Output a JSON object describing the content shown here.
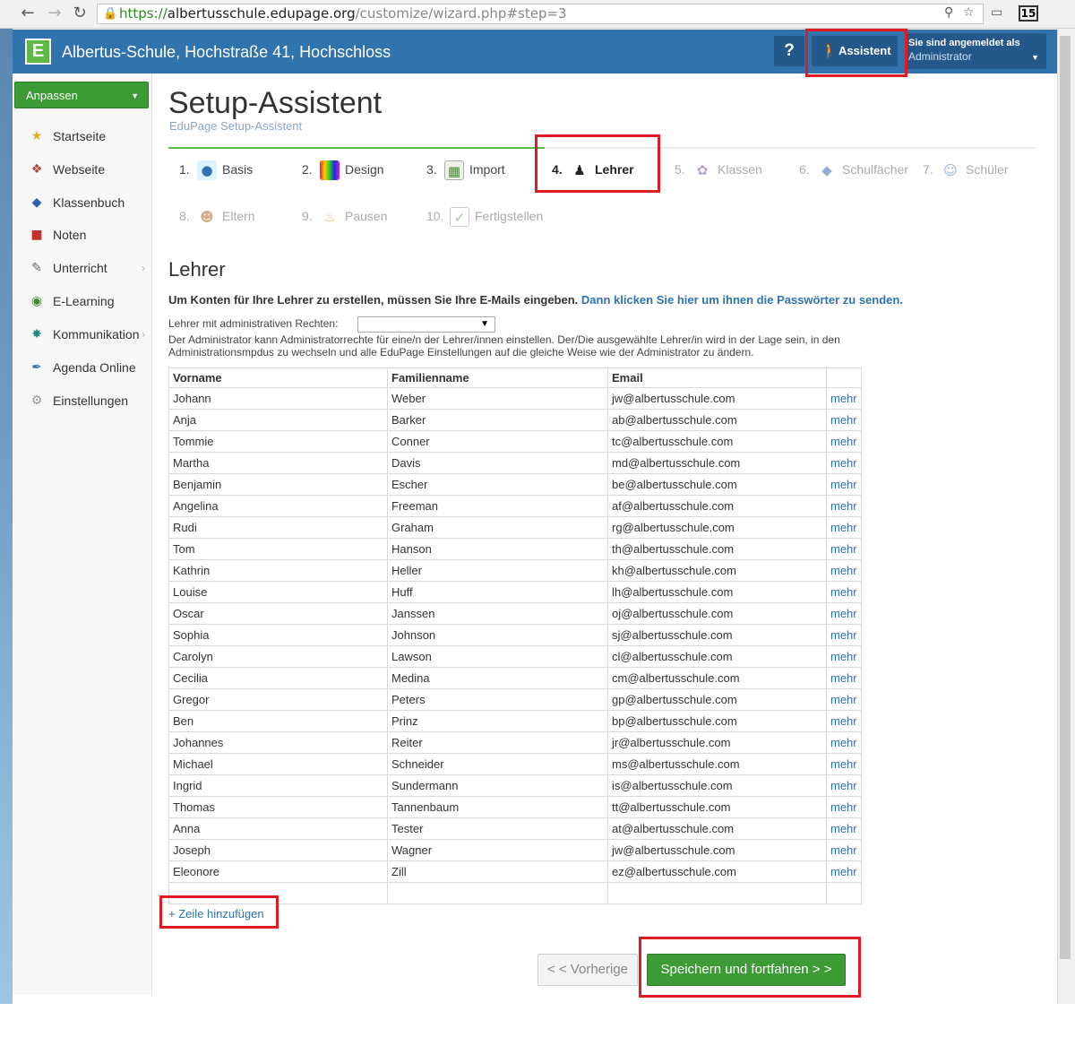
{
  "browser": {
    "url_protocol": "https://",
    "url_host": "albertusschule.edupage.org",
    "url_path": "/customize/wizard.php#step=3",
    "badge": "15"
  },
  "header": {
    "logo_letter": "E",
    "school_name": "Albertus-Schule, Hochstraße 41, Hochschloss",
    "help_label": "?",
    "assistant_label": "Assistent",
    "login_line1": "Sie sind angemeldet als",
    "login_line2": "Administrator"
  },
  "sidebar": {
    "customize_label": "Anpassen",
    "items": [
      {
        "label": "Startseite"
      },
      {
        "label": "Webseite"
      },
      {
        "label": "Klassenbuch"
      },
      {
        "label": "Noten"
      },
      {
        "label": "Unterricht"
      },
      {
        "label": "E-Learning"
      },
      {
        "label": "Kommunikation"
      },
      {
        "label": "Agenda Online"
      },
      {
        "label": "Einstellungen"
      }
    ]
  },
  "main": {
    "title": "Setup-Assistent",
    "subtitle": "EduPage Setup-Assistent",
    "steps": [
      {
        "num": "1.",
        "label": "Basis"
      },
      {
        "num": "2.",
        "label": "Design"
      },
      {
        "num": "3.",
        "label": "Import"
      },
      {
        "num": "4.",
        "label": "Lehrer"
      },
      {
        "num": "5.",
        "label": "Klassen"
      },
      {
        "num": "6.",
        "label": "Schulfächer"
      },
      {
        "num": "7.",
        "label": "Schüler"
      },
      {
        "num": "8.",
        "label": "Eltern"
      },
      {
        "num": "9.",
        "label": "Pausen"
      },
      {
        "num": "10.",
        "label": "Fertigstellen"
      }
    ],
    "section_title": "Lehrer",
    "intro_text": "Um Konten für Ihre Lehrer zu erstellen, müssen Sie Ihre E-Mails eingeben.",
    "intro_link": "Dann klicken Sie hier um ihnen die Passwörter zu senden.",
    "admin_label": "Lehrer mit administrativen Rechten:",
    "admin_select_value": "",
    "admin_desc": "Der Administrator kann Administratorrechte für eine/n der Lehrer/innen einstellen. Der/Die ausgewählte Lehrer/in wird in der Lage sein, in den Administrationsmpdus zu wechseln und alle EduPage Einstellungen auf die gleiche Weise wie der Administrator zu ändern.",
    "table": {
      "headers": [
        "Vorname",
        "Familienname",
        "Email",
        ""
      ],
      "more_label": "mehr",
      "rows": [
        [
          "Johann",
          " Weber",
          "jw@albertusschule.com"
        ],
        [
          "Anja",
          "Barker",
          "ab@albertusschule.com"
        ],
        [
          "Tommie",
          "Conner",
          "tc@albertusschule.com"
        ],
        [
          "Martha",
          "Davis",
          "md@albertusschule.com"
        ],
        [
          "Benjamin",
          "Escher",
          "be@albertusschule.com"
        ],
        [
          "Angelina",
          "Freeman",
          "af@albertusschule.com"
        ],
        [
          "Rudi",
          "Graham",
          "rg@albertusschule.com"
        ],
        [
          "Tom",
          "Hanson",
          "th@albertusschule.com"
        ],
        [
          "Kathrin",
          "Heller",
          "kh@albertusschule.com"
        ],
        [
          "Louise",
          "Huff",
          "lh@albertusschule.com"
        ],
        [
          "Oscar",
          "Janssen",
          "oj@albertusschule.com"
        ],
        [
          "Sophia",
          "Johnson",
          "sj@albertusschule.com"
        ],
        [
          "Carolyn",
          "Lawson",
          "cl@albertusschule.com"
        ],
        [
          "Cecilia",
          "Medina",
          "cm@albertusschule.com"
        ],
        [
          "Gregor",
          "Peters",
          "gp@albertusschule.com"
        ],
        [
          "Ben",
          "Prinz",
          "bp@albertusschule.com"
        ],
        [
          "Johannes",
          "Reiter",
          "jr@albertusschule.com"
        ],
        [
          "Michael",
          "Schneider",
          "ms@albertusschule.com"
        ],
        [
          "Ingrid",
          "Sundermann",
          "is@albertusschule.com"
        ],
        [
          "Thomas",
          "Tannenbaum",
          "tt@albertusschule.com"
        ],
        [
          "Anna",
          "Tester",
          "at@albertusschule.com"
        ],
        [
          "Joseph",
          "Wagner",
          "jw@albertusschule.com"
        ],
        [
          "Eleonore",
          "Zill",
          "ez@albertusschule.com"
        ]
      ]
    },
    "add_row_label": "+ Zeile hinzufügen",
    "prev_label": "< < Vorherige",
    "next_label": "Speichern und fortfahren > >"
  },
  "colors": {
    "header_blue": "#3173ad",
    "accent_green": "#3d9b35",
    "link_blue": "#2f73b0",
    "highlight_red": "#e01b24"
  },
  "icons": [
    "back-arrow-icon",
    "forward-arrow-icon",
    "reload-icon",
    "lock-icon",
    "zoom-icon",
    "star-icon",
    "window-icon",
    "assistant-walking-icon",
    "dropdown-caret-icon"
  ]
}
